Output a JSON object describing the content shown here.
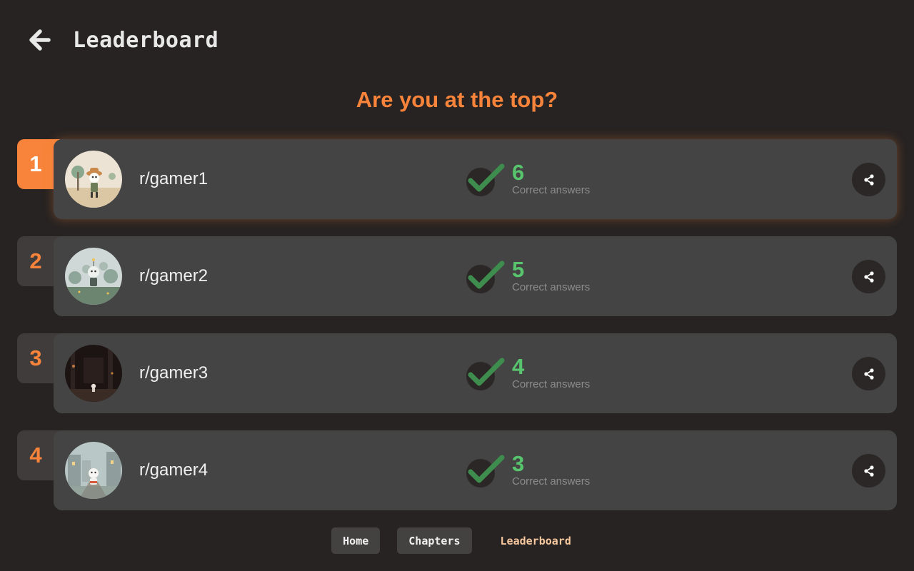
{
  "header": {
    "title": "Leaderboard",
    "back_icon": "arrow-left-icon"
  },
  "subtitle": "Are you at the top?",
  "leaderboard": [
    {
      "rank": "1",
      "username": "r/gamer1",
      "score": "6",
      "score_label": "Correct answers",
      "avatar_icon": "avatar-desert-explorer-icon"
    },
    {
      "rank": "2",
      "username": "r/gamer2",
      "score": "5",
      "score_label": "Correct answers",
      "avatar_icon": "avatar-misty-forest-icon"
    },
    {
      "rank": "3",
      "username": "r/gamer3",
      "score": "4",
      "score_label": "Correct answers",
      "avatar_icon": "avatar-dark-forest-icon"
    },
    {
      "rank": "4",
      "username": "r/gamer4",
      "score": "3",
      "score_label": "Correct answers",
      "avatar_icon": "avatar-village-street-icon"
    }
  ],
  "nav": {
    "home": "Home",
    "chapters": "Chapters",
    "leaderboard": "Leaderboard"
  },
  "colors": {
    "background": "#272322",
    "accent": "#f7843a",
    "card": "#444444",
    "score_green": "#58c46e",
    "active_nav": "#f7c79e"
  }
}
